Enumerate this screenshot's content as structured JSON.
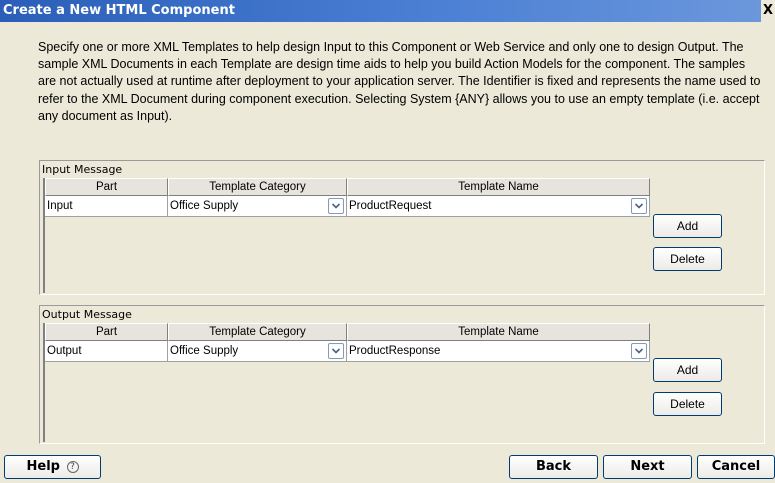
{
  "window": {
    "title": "Create a New HTML Component",
    "close_glyph": "X"
  },
  "description": "Specify one or more XML Templates to help design Input to this Component or Web Service and only one to design Output.  The sample XML Documents in each Template are design time aids to help you build Action Models for the component.  The samples are not actually used at runtime after deployment to your application server.  The Identifier is fixed and represents the name used to refer to the XML Document during component execution.  Selecting System {ANY} allows you to use an empty template (i.e. accept any document as Input).",
  "columns": {
    "part": "Part",
    "category": "Template Category",
    "name": "Template Name"
  },
  "input_message": {
    "title": "Input Message",
    "row": {
      "part": "Input",
      "category": "Office Supply",
      "name": "ProductRequest"
    },
    "add_label": "Add",
    "delete_label": "Delete"
  },
  "output_message": {
    "title": "Output Message",
    "row": {
      "part": "Output",
      "category": "Office Supply",
      "name": "ProductResponse"
    },
    "add_label": "Add",
    "delete_label": "Delete"
  },
  "footer": {
    "help_label": "Help",
    "help_icon": "?",
    "back_label": "Back",
    "next_label": "Next",
    "cancel_label": "Cancel"
  },
  "colors": {
    "titlebar": "#2a5eb8",
    "dialog_bg": "#ece9d8",
    "button_border": "#003c74"
  }
}
